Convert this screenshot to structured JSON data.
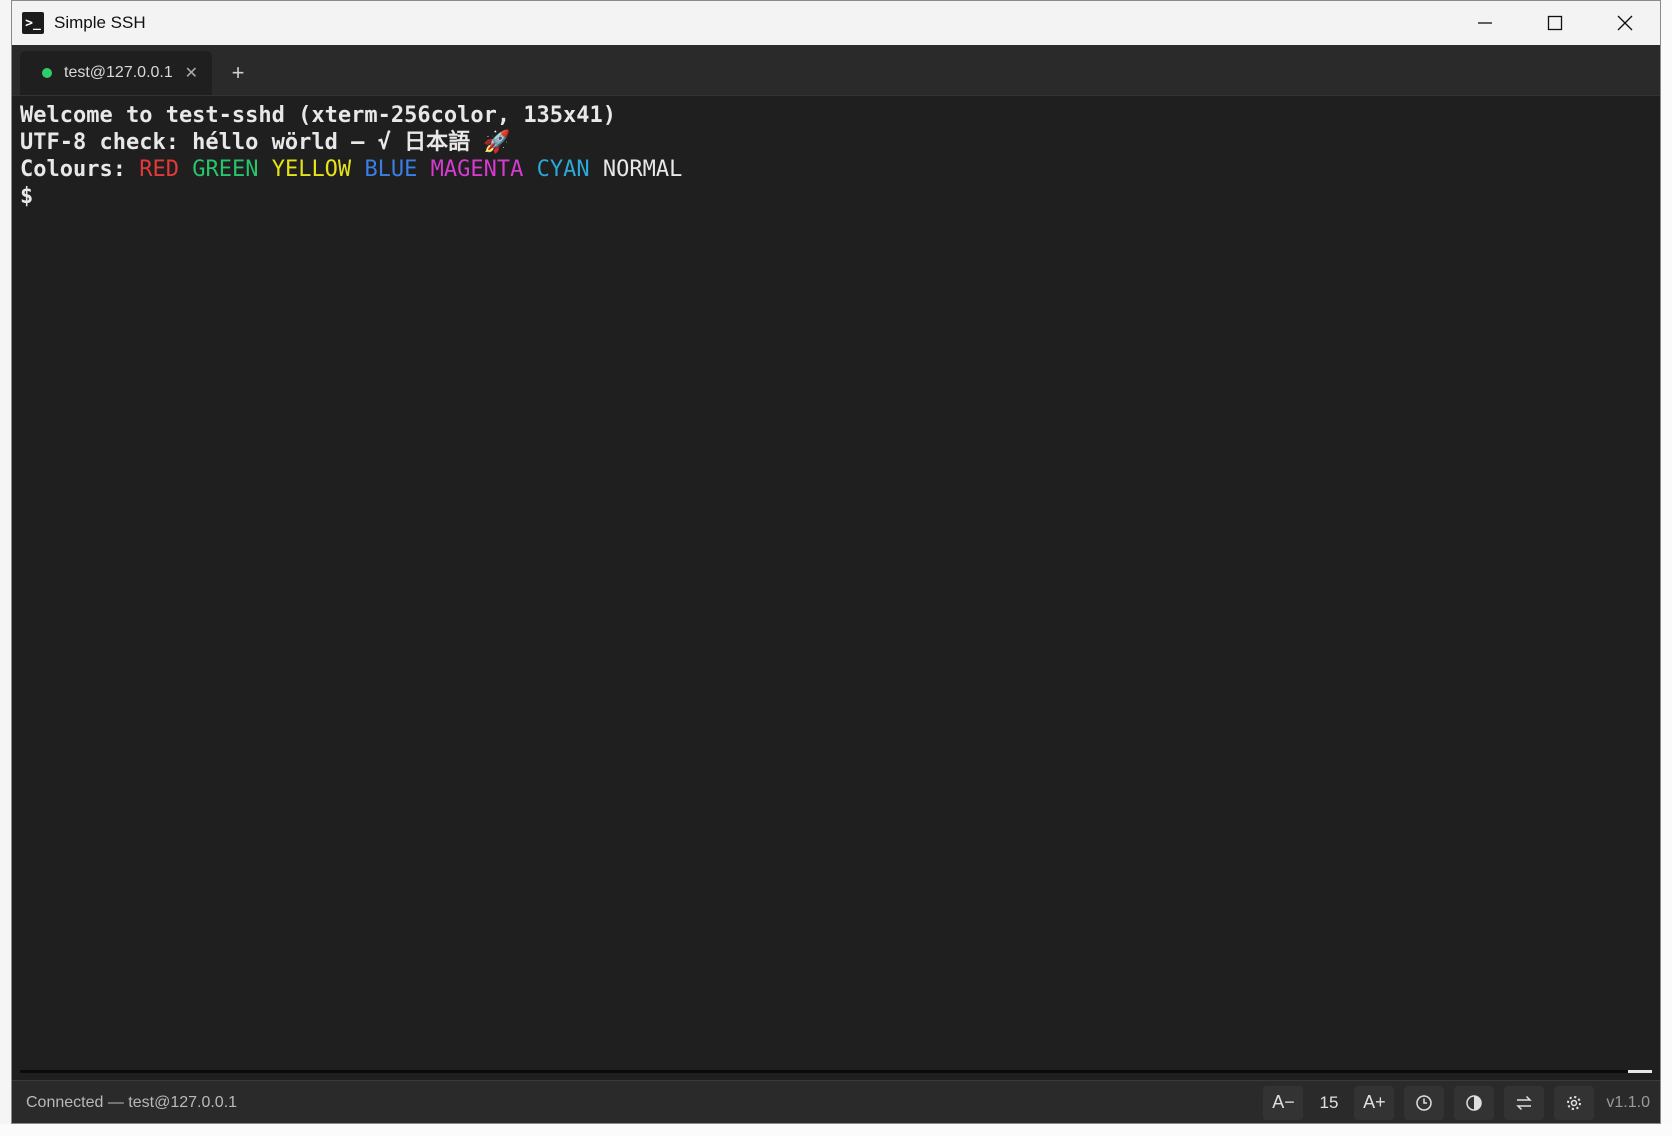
{
  "window": {
    "title": "Simple SSH",
    "icon": "terminal-icon"
  },
  "tabs": [
    {
      "label": "test@127.0.0.1",
      "status": "connected",
      "status_color": "#2fcf6c"
    }
  ],
  "terminal": {
    "lines": {
      "welcome": "Welcome to test-sshd (xterm-256color, 135x41)",
      "utf8": "UTF-8 check: héllo wörld — √ 日本語 🚀",
      "colours_label": "Colours:",
      "prompt": "$"
    },
    "colours": {
      "red": "RED",
      "green": "GREEN",
      "yellow": "YELLOW",
      "blue": "BLUE",
      "magenta": "MAGENTA",
      "cyan": "CYAN",
      "normal": "NORMAL"
    },
    "colour_values": {
      "red": "#e23a3a",
      "green": "#27c46a",
      "yellow": "#e6e21a",
      "blue": "#3a7fe6",
      "magenta": "#d63ad0",
      "cyan": "#2aa8d8"
    }
  },
  "statusbar": {
    "status": "Connected — test@127.0.0.1",
    "font_decrease": "A−",
    "font_size": "15",
    "font_increase": "A+",
    "version": "v1.1.0"
  }
}
